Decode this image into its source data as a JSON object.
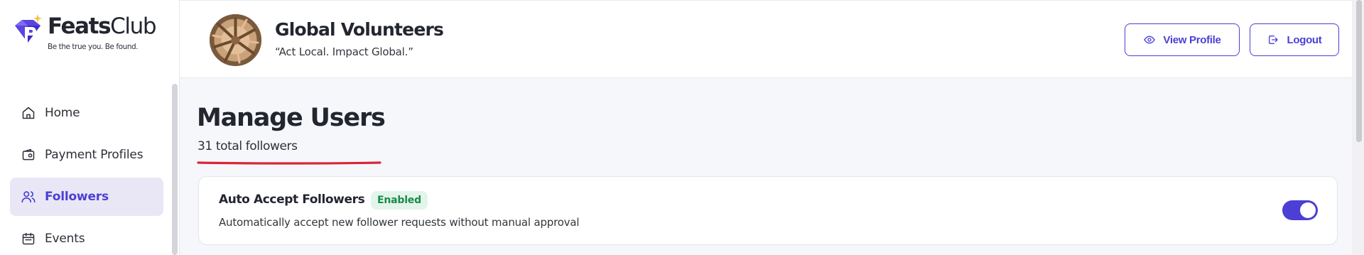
{
  "brand": {
    "name_bold": "Feats",
    "name_light": "Club",
    "tagline": "Be the true you. Be found."
  },
  "sidebar": {
    "items": [
      {
        "label": "Home",
        "icon": "home-icon",
        "active": false
      },
      {
        "label": "Payment Profiles",
        "icon": "wallet-icon",
        "active": false
      },
      {
        "label": "Followers",
        "icon": "users-icon",
        "active": true
      },
      {
        "label": "Events",
        "icon": "calendar-icon",
        "active": false
      }
    ]
  },
  "header": {
    "org_name": "Global Volunteers",
    "org_quote": "“Act Local. Impact Global.”",
    "view_profile_label": "View Profile",
    "view_profile_icon": "eye-icon",
    "logout_label": "Logout",
    "logout_icon": "logout-icon"
  },
  "main": {
    "title": "Manage Users",
    "followers_count": "31 total followers",
    "auto_accept": {
      "title": "Auto Accept Followers",
      "badge": "Enabled",
      "description": "Automatically accept new follower requests without manual approval",
      "enabled": true
    }
  },
  "colors": {
    "accent": "#4b3fd6",
    "active_bg": "#e9e7f6",
    "badge_bg": "#e3f5ea",
    "badge_text": "#1a8a4c",
    "underline": "#d8263a"
  }
}
